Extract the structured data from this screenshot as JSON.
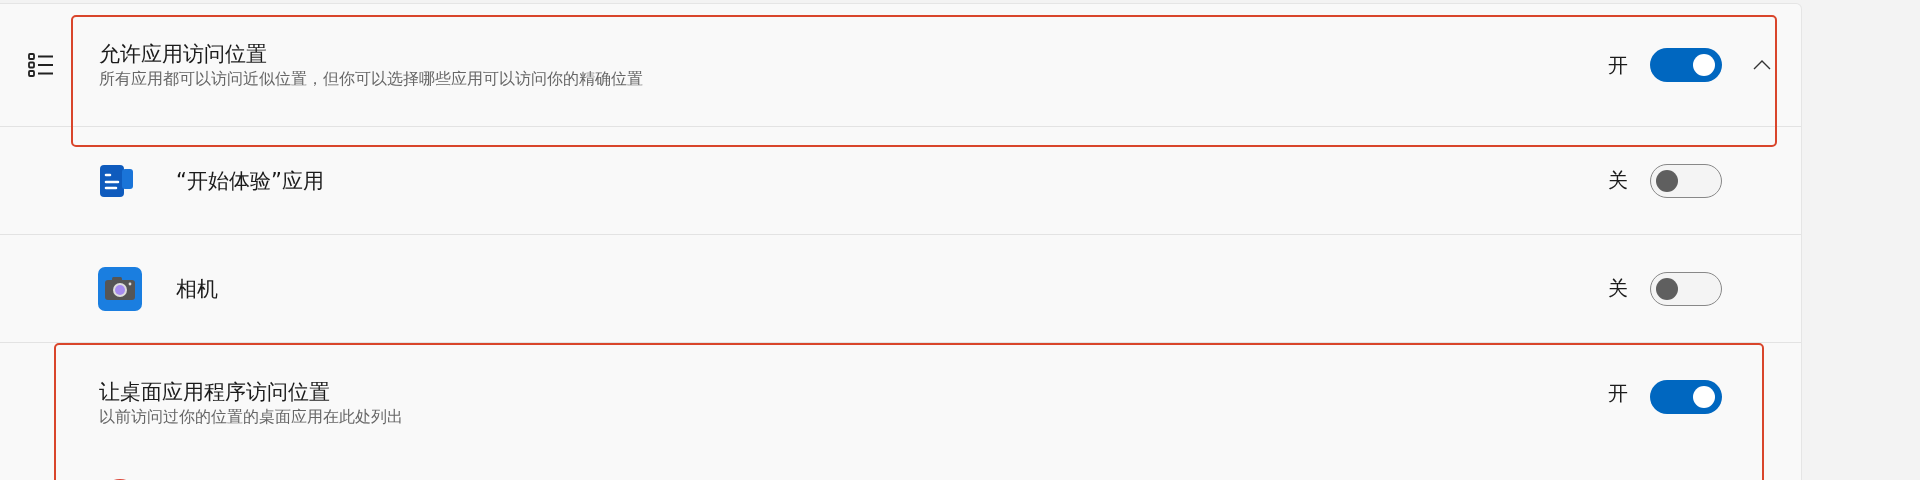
{
  "sections": [
    {
      "kind": "header",
      "title": "允许应用访问位置",
      "description": "所有应用都可以访问近似位置，但你可以选择哪些应用可以访问你的精确位置",
      "state_label": "开",
      "on": true,
      "expanded": true
    },
    {
      "kind": "tips",
      "title": "“开始体验”应用",
      "state_label": "关",
      "on": false
    },
    {
      "kind": "camera",
      "title": "相机",
      "state_label": "关",
      "on": false
    },
    {
      "kind": "subheader",
      "title": "让桌面应用程序访问位置",
      "description": "以前访问过你的位置的桌面应用在此处列出",
      "state_label": "开",
      "on": true
    }
  ]
}
